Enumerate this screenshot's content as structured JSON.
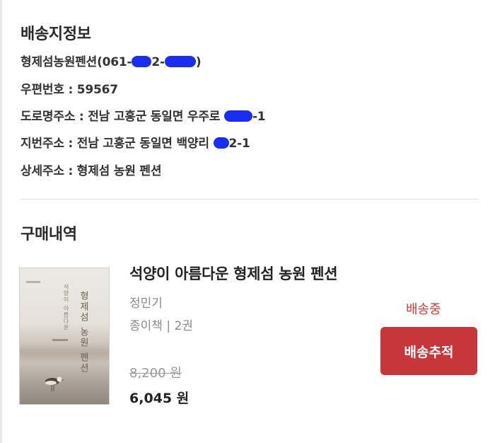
{
  "shipping": {
    "title": "배송지정보",
    "recipient_prefix": "형제섬농원펜션(061-",
    "recipient_mid": "2-",
    "recipient_suffix": ")",
    "postal_label": "우편번호 : 59567",
    "road_prefix": "도로명주소 : 전남 고흥군 동일면 우주로 ",
    "road_suffix": "-1",
    "lot_prefix": "지번주소 : 전남 고흥군 동일면 백양리 ",
    "lot_suffix": "2-1",
    "detail_label": "상세주소 : 형제섬 농원 펜션"
  },
  "purchase": {
    "title": "구매내역",
    "item": {
      "title": "석양이 아름다운 형제섬 농원 펜션",
      "author": "정민기",
      "format": "종이책 | 2권",
      "original_price": "8,200 원",
      "final_price": "6,045 원",
      "status": "배송중",
      "track_button": "배송추적",
      "cover_title": "형제섬 농원 펜션",
      "cover_subtitle": "석양이 아름다운"
    }
  },
  "colors": {
    "accent_red": "#c5373a",
    "status_red": "#cc3b3b",
    "redaction_blue": "#1a2ef0"
  }
}
